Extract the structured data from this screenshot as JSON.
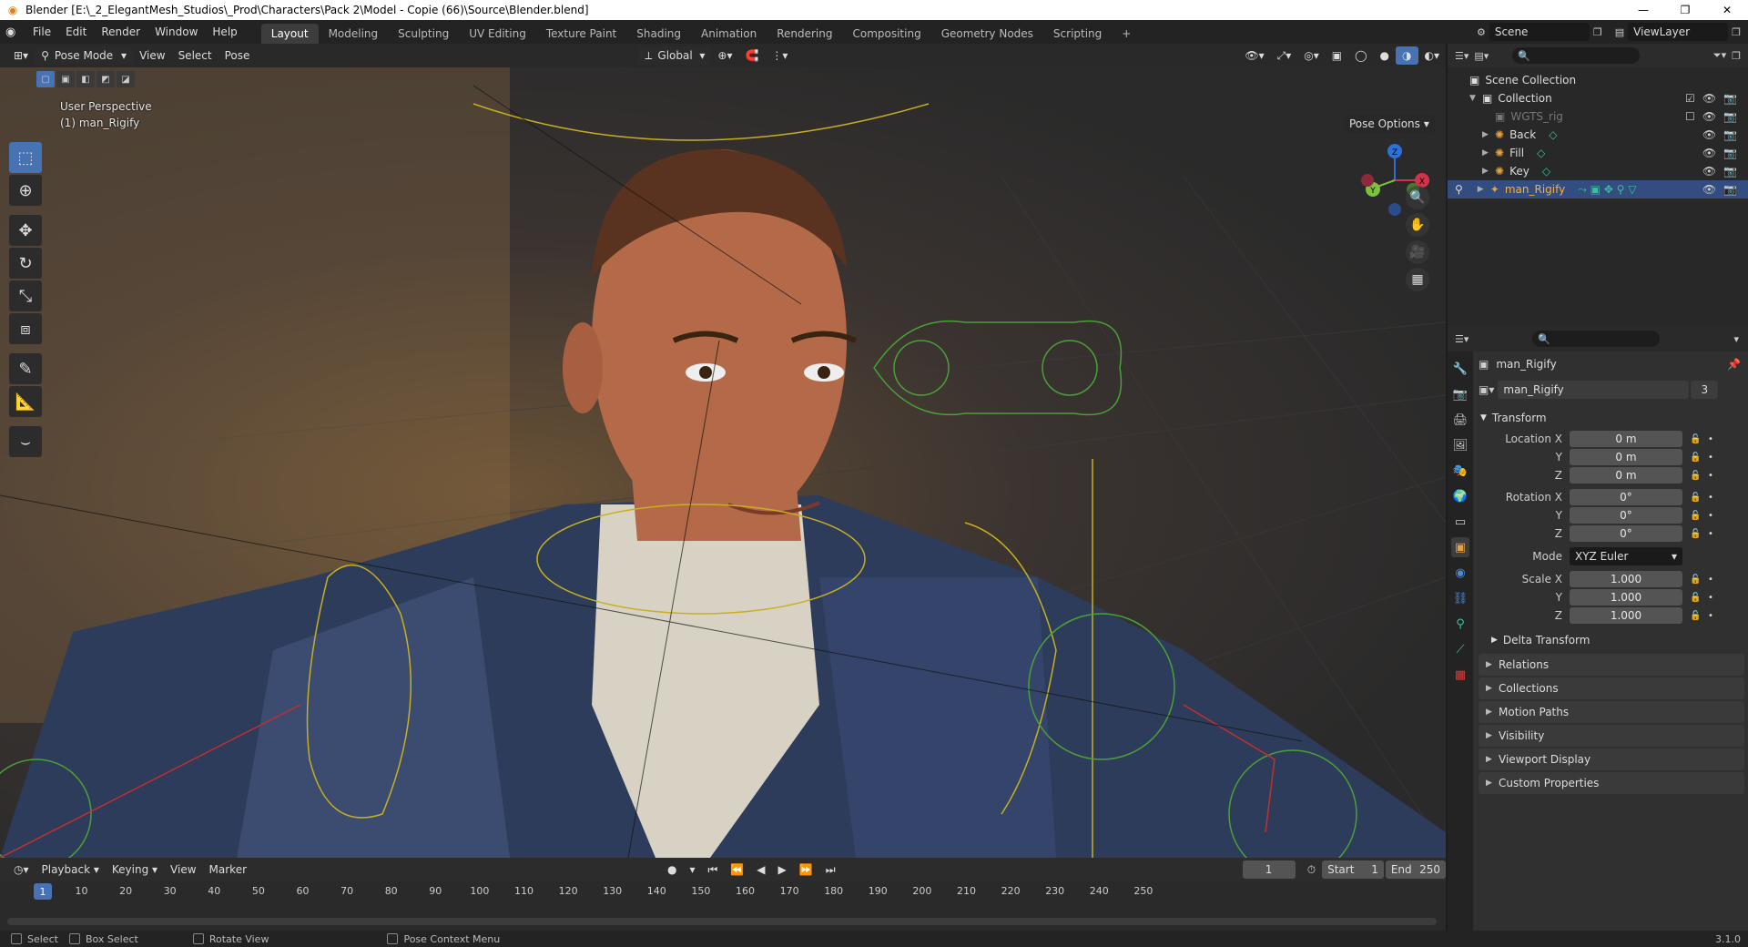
{
  "window": {
    "title": "Blender [E:\\_2_ElegantMesh_Studios\\_Prod\\Characters\\Pack 2\\Model - Copie (66)\\Source\\Blender.blend]",
    "minimize": "—",
    "maximize": "❐",
    "close": "✕"
  },
  "menu": [
    "File",
    "Edit",
    "Render",
    "Window",
    "Help"
  ],
  "workspaces": [
    "Layout",
    "Modeling",
    "Sculpting",
    "UV Editing",
    "Texture Paint",
    "Shading",
    "Animation",
    "Rendering",
    "Compositing",
    "Geometry Nodes",
    "Scripting",
    "+"
  ],
  "scene_selector": {
    "scene": "Scene",
    "view_layer": "ViewLayer"
  },
  "viewport": {
    "mode": "Pose Mode",
    "menus": [
      "View",
      "Select",
      "Pose"
    ],
    "orientation": "Global",
    "info_line1": "User Perspective",
    "info_line2": "(1) man_Rigify",
    "pose_options": "Pose Options",
    "gizmo": {
      "x": "X",
      "y": "Y",
      "z": "Z"
    }
  },
  "outliner": {
    "search_placeholder": "",
    "rows": [
      {
        "label": "Scene Collection"
      },
      {
        "label": "Collection"
      },
      {
        "label": "WGTS_rig"
      },
      {
        "label": "Back"
      },
      {
        "label": "Fill"
      },
      {
        "label": "Key"
      },
      {
        "label": "man_Rigify"
      }
    ]
  },
  "properties": {
    "object_name": "man_Rigify",
    "data_name": "man_Rigify",
    "users": "3",
    "transform_title": "Transform",
    "location_label": "Location X",
    "location": [
      "0 m",
      "0 m",
      "0 m"
    ],
    "rotation_label": "Rotation X",
    "rotation": [
      "0°",
      "0°",
      "0°"
    ],
    "mode_label": "Mode",
    "mode_value": "XYZ Euler",
    "scale_label": "Scale X",
    "scale": [
      "1.000",
      "1.000",
      "1.000"
    ],
    "axis_y": "Y",
    "axis_z": "Z",
    "delta": "Delta Transform",
    "sections": [
      "Relations",
      "Collections",
      "Motion Paths",
      "Visibility",
      "Viewport Display",
      "Custom Properties"
    ]
  },
  "timeline": {
    "menus": [
      "Playback",
      "Keying",
      "View",
      "Marker"
    ],
    "current_frame": "1",
    "start_label": "Start",
    "start": "1",
    "end_label": "End",
    "end": "250",
    "ruler": [
      "10",
      "20",
      "30",
      "40",
      "50",
      "60",
      "70",
      "80",
      "90",
      "100",
      "110",
      "120",
      "130",
      "140",
      "150",
      "160",
      "170",
      "180",
      "190",
      "200",
      "210",
      "220",
      "230",
      "240",
      "250"
    ],
    "playhead": "1"
  },
  "statusbar": {
    "select": "Select",
    "box_select": "Box Select",
    "rotate_view": "Rotate View",
    "context_menu": "Pose Context Menu",
    "version": "3.1.0"
  }
}
